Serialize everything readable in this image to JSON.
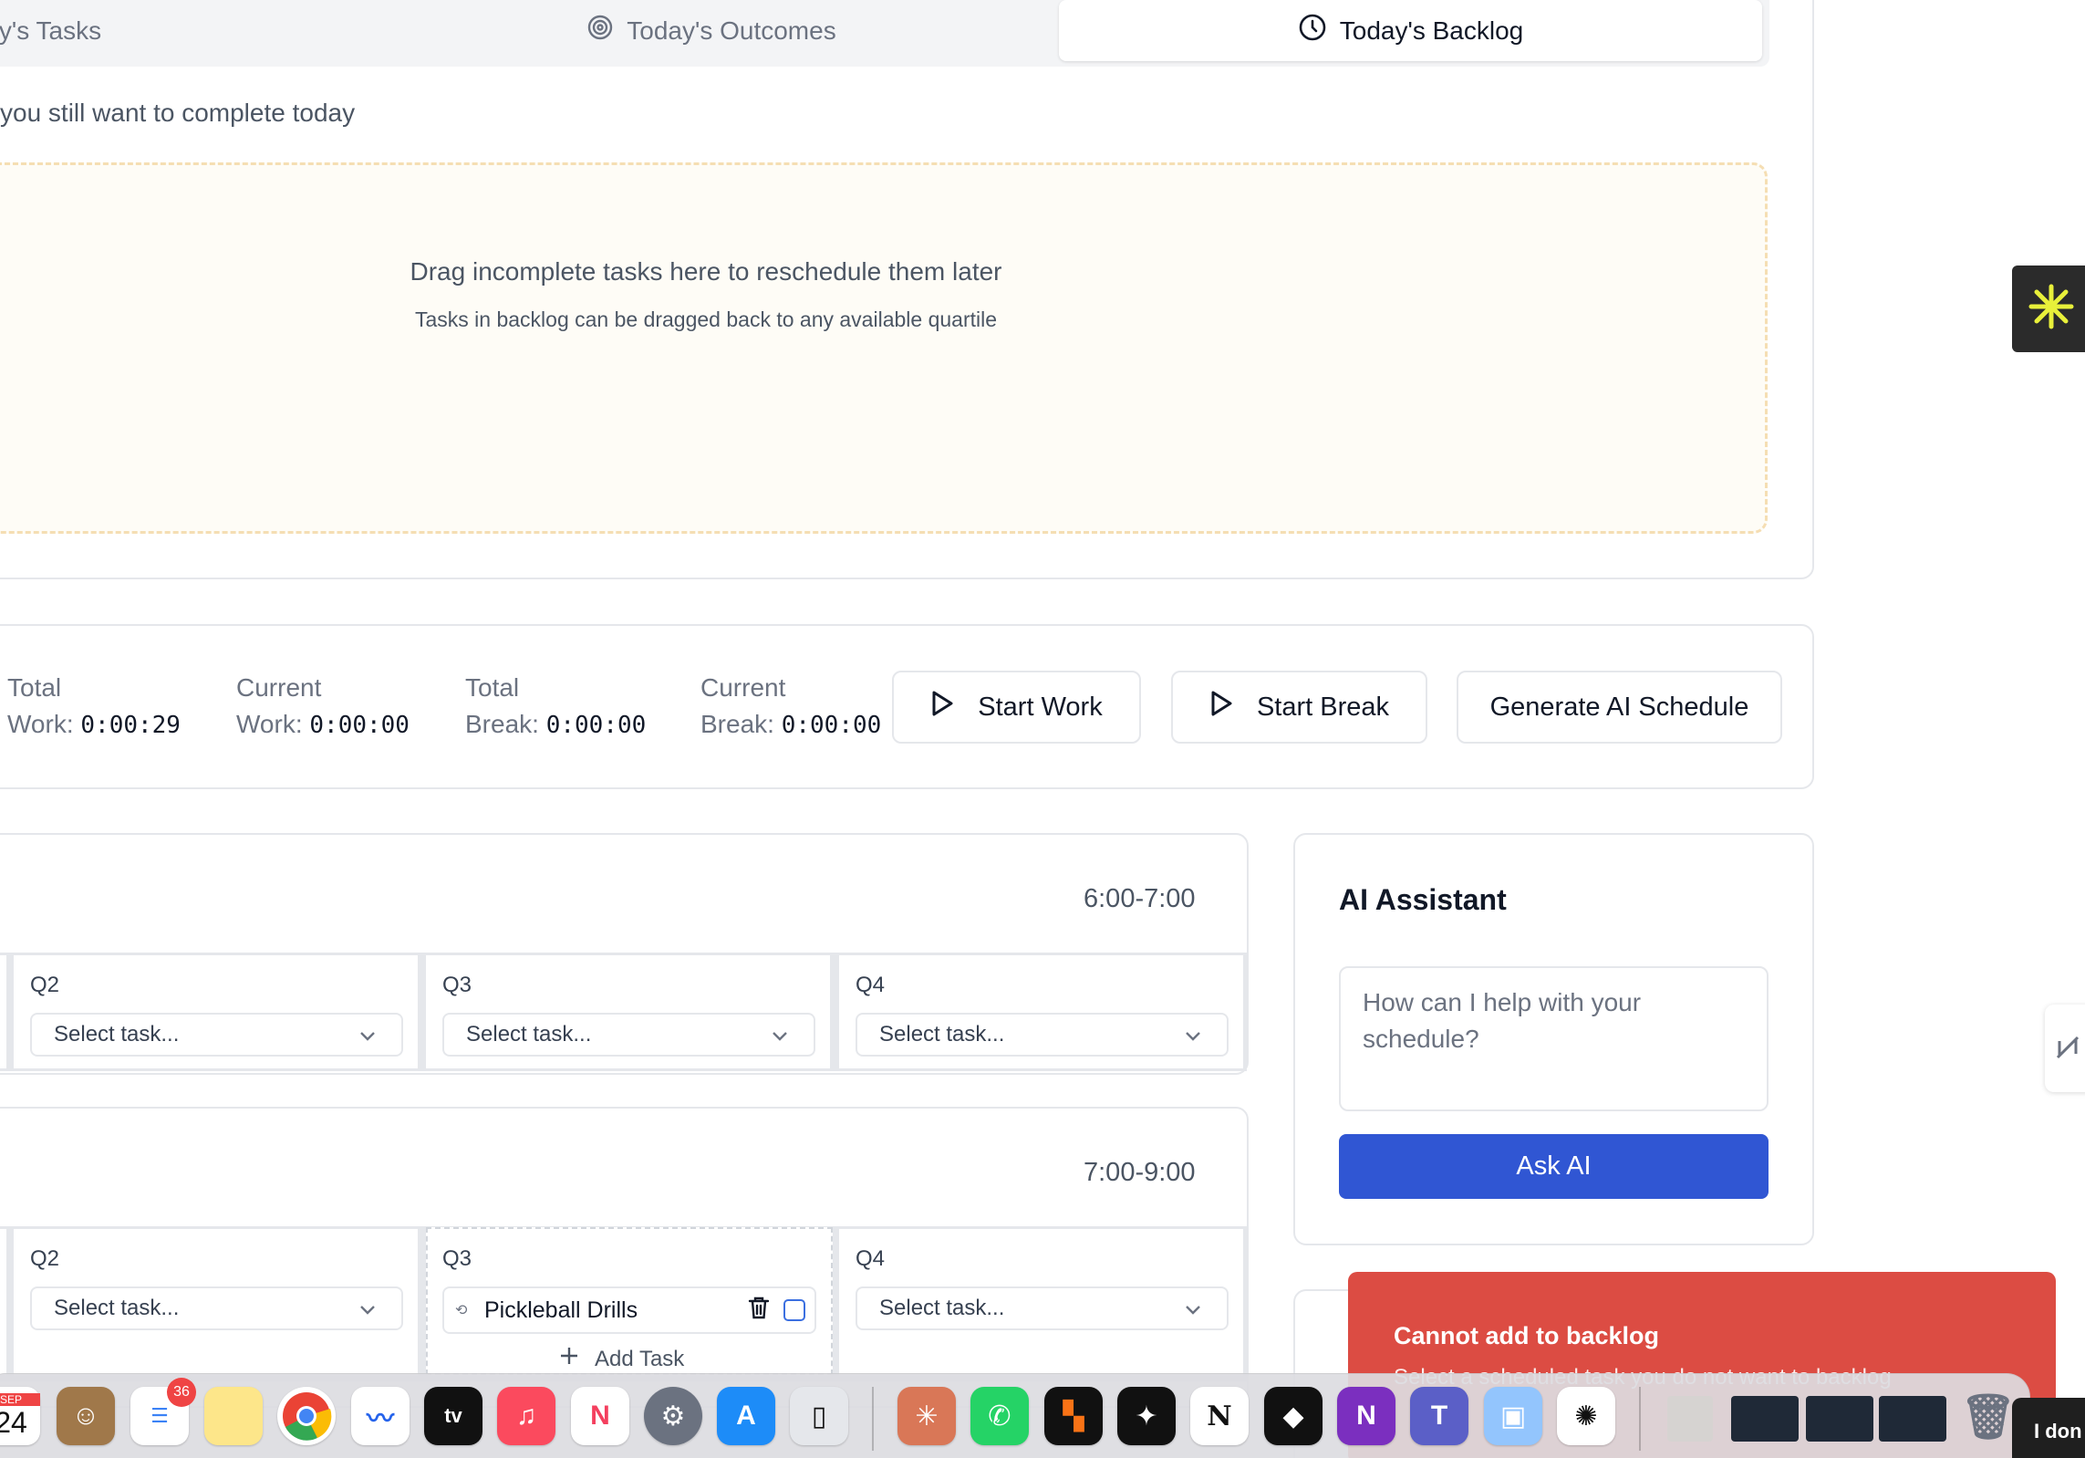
{
  "tabs": [
    {
      "label": "y's Tasks",
      "icon": "list-icon",
      "active": false
    },
    {
      "label": "Today's Outcomes",
      "icon": "target-icon",
      "active": false
    },
    {
      "label": "Today's Backlog",
      "icon": "clock-icon",
      "active": true
    }
  ],
  "backlog": {
    "subtitle": "you still want to complete today",
    "drop_main": "Drag incomplete tasks here to reschedule them later",
    "drop_sub": "Tasks in backlog can be dragged back to any available quartile"
  },
  "timers": [
    {
      "label": "Total",
      "label2": "Work:",
      "value": "0:00:29"
    },
    {
      "label": "Current",
      "label2": "Work:",
      "value": "0:00:00"
    },
    {
      "label": "Total",
      "label2": "Break:",
      "value": "0:00:00"
    },
    {
      "label": "Current",
      "label2": "Break:",
      "value": "0:00:00"
    }
  ],
  "buttons": {
    "start_work": "Start Work",
    "start_break": "Start Break",
    "generate": "Generate AI Schedule"
  },
  "blocks": [
    {
      "time": "6:00-7:00",
      "quarters": [
        {
          "label": "Q2",
          "select": "Select task..."
        },
        {
          "label": "Q3",
          "select": "Select task..."
        },
        {
          "label": "Q4",
          "select": "Select task..."
        }
      ]
    },
    {
      "time": "7:00-9:00",
      "quarters": [
        {
          "label": "Q2",
          "select": "Select task..."
        },
        {
          "label": "Q3",
          "task": "Pickleball Drills",
          "add_task": "Add Task"
        },
        {
          "label": "Q4",
          "select": "Select task..."
        }
      ]
    }
  ],
  "ai": {
    "title": "AI Assistant",
    "placeholder": "How can I help with your schedule?",
    "button": "Ask AI"
  },
  "toast": {
    "title": "Cannot add to backlog",
    "description": "Select a scheduled task you do not want to backlog"
  },
  "dock": {
    "calendar_month": "SEP",
    "calendar_day": "24",
    "reminders_badge": "36",
    "corner_tip": "I don"
  },
  "colors": {
    "accent_blue": "#3056d3",
    "toast_red": "#dc4c43",
    "dropzone_bg": "#fefcf6"
  }
}
